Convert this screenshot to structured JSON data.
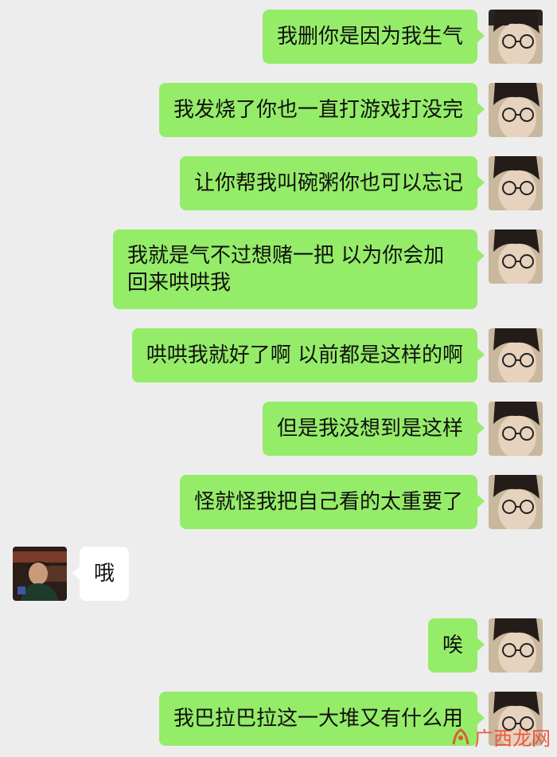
{
  "messages": [
    {
      "side": "out",
      "text": "我删你是因为我生气",
      "avatar": "girl-avatar"
    },
    {
      "side": "out",
      "text": "我发烧了你也一直打游戏打没完",
      "avatar": "girl-avatar"
    },
    {
      "side": "out",
      "text": "让你帮我叫碗粥你也可以忘记",
      "avatar": "girl-avatar"
    },
    {
      "side": "out",
      "text": "我就是气不过想赌一把 以为你会加回来哄哄我",
      "avatar": "girl-avatar"
    },
    {
      "side": "out",
      "text": "哄哄我就好了啊 以前都是这样的啊",
      "avatar": "girl-avatar"
    },
    {
      "side": "out",
      "text": "但是我没想到是这样",
      "avatar": "girl-avatar"
    },
    {
      "side": "out",
      "text": "怪就怪我把自己看的太重要了",
      "avatar": "girl-avatar"
    },
    {
      "side": "in",
      "text": "哦",
      "avatar": "boy-avatar"
    },
    {
      "side": "out",
      "text": "唉",
      "avatar": "girl-avatar"
    },
    {
      "side": "out",
      "text": "我巴拉巴拉这一大堆又有什么用",
      "avatar": "girl-avatar"
    }
  ],
  "colors": {
    "background": "#ededed",
    "outgoing_bubble": "#95ec69",
    "incoming_bubble": "#ffffff",
    "watermark": "#e8442b"
  },
  "watermark": {
    "text": "广西龙网",
    "icon": "watermark-logo-icon"
  }
}
